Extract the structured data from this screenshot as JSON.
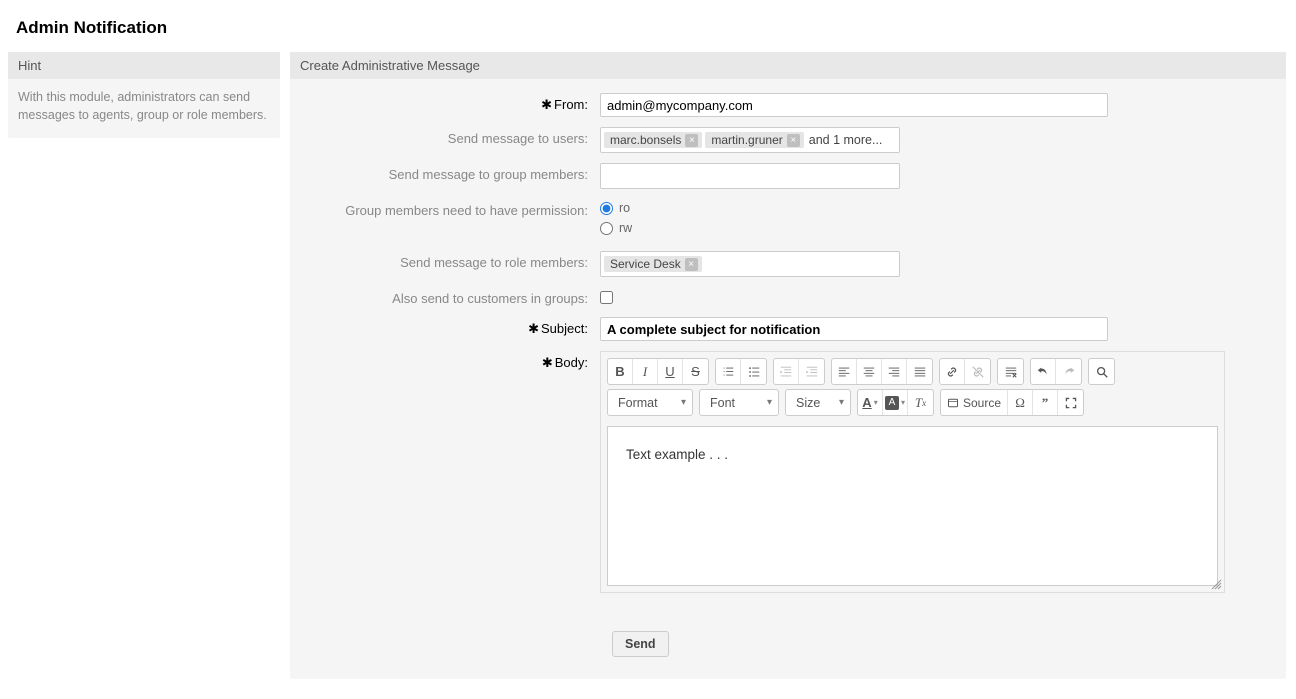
{
  "page_title": "Admin Notification",
  "hint": {
    "title": "Hint",
    "text": "With this module, administrators can send messages to agents, group or role members."
  },
  "main_title": "Create Administrative Message",
  "labels": {
    "from": "From:",
    "to_users": "Send message to users:",
    "to_groups": "Send message to group members:",
    "perm": "Group members need to have permission:",
    "to_roles": "Send message to role members:",
    "to_customers": "Also send to customers in groups:",
    "subject": "Subject:",
    "body": "Body:"
  },
  "values": {
    "from": "admin@mycompany.com",
    "users": [
      "marc.bonsels",
      "martin.gruner"
    ],
    "users_more": "and 1 more...",
    "roles": [
      "Service Desk"
    ],
    "perm_ro": "ro",
    "perm_rw": "rw",
    "perm_selected": "ro",
    "customers_checked": false,
    "subject": "A complete subject for notification",
    "body": "Text example . . ."
  },
  "toolbar": {
    "format": "Format",
    "font": "Font",
    "size": "Size",
    "source": "Source"
  },
  "send_label": "Send"
}
